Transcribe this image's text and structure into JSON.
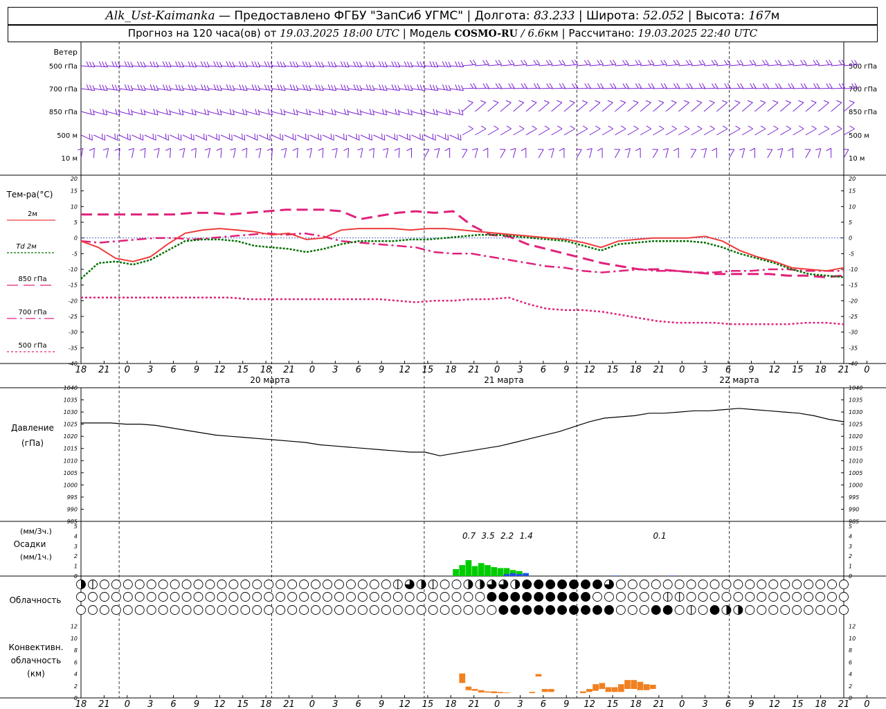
{
  "header": {
    "station": "Alk_Ust-Kaimanka",
    "provider": "— Предоставлено ФГБУ \"ЗапСиб УГМС\" | Долгота:",
    "lon": "83.233",
    "lat_label": "| Широта:",
    "lat": "52.052",
    "alt_label": "| Высота:",
    "alt": "167",
    "alt_unit": "м",
    "forecast_label": "Прогноз на 120 часа(ов) от",
    "forecast_from": "19.03.2025 18:00 UTC",
    "model_label": "| Модель",
    "model": "COSMO-RU",
    "resolution": "/ 6.6",
    "resolution_unit": "км",
    "calc_label": "| Рассчитано:",
    "calc_time": "19.03.2025 22:40 UTC"
  },
  "labels": {
    "wind_title": "Ветер",
    "wind_levels": [
      "500 гПа",
      "700 гПа",
      "850 гПа",
      "500 м",
      "10 м"
    ],
    "temp_title": "Тем-ра(°С)",
    "legend": [
      "2м",
      "Td 2м",
      "850 гПа",
      "700 гПа",
      "500 гПа"
    ],
    "pressure_title": "Давление",
    "pressure_unit": "(гПа)",
    "precip_unit_3h": "(мм/3ч.)",
    "precip_title": "Осадки",
    "precip_unit_1h": "(мм/1ч.)",
    "cloud_title": "Облачность",
    "conv_title_1": "Конвективн.",
    "conv_title_2": "облачность",
    "conv_unit": "(км)"
  },
  "colors": {
    "wind": "#7a1fd2",
    "t2m": "#ee3b3b",
    "td2m": "#007000",
    "t850": "#e0207a",
    "t700": "#e0207a",
    "t500": "#e0207a",
    "precip_rain": "#00cc00",
    "precip_snow": "#2050e0",
    "conv": "#f08020"
  },
  "chart_data": {
    "type": "meteogram",
    "x_hours": [
      0,
      3,
      6,
      9,
      12,
      15,
      18,
      21,
      24,
      27,
      30,
      33,
      36,
      39,
      42,
      45,
      48,
      51,
      54,
      57,
      60,
      63,
      66,
      69,
      72,
      75,
      78,
      81,
      84,
      87,
      90,
      93,
      96,
      99,
      102,
      105,
      108,
      111,
      114,
      117,
      120
    ],
    "x_tick_labels": [
      "18",
      "21",
      "0",
      "3",
      "6",
      "9",
      "12",
      "15",
      "18",
      "21",
      "0",
      "3",
      "6",
      "9",
      "12",
      "15",
      "18",
      "21",
      "0",
      "3",
      "6",
      "9",
      "12",
      "15",
      "18",
      "21",
      "0",
      "3",
      "6",
      "9",
      "12",
      "15",
      "18",
      "21",
      "0"
    ],
    "date_labels": [
      "20 марта",
      "21 марта",
      "22 марта"
    ],
    "temperature": {
      "ylim": [
        -40,
        20
      ],
      "yticks": [
        20,
        15,
        10,
        5,
        0,
        -5,
        -10,
        -15,
        -20,
        -25,
        -30,
        -35,
        -40
      ],
      "t2m": [
        -1,
        -3,
        -6.5,
        -7.5,
        -6,
        -2,
        1.5,
        2.5,
        3,
        2.5,
        2,
        1,
        1.5,
        -0.5,
        0,
        2.5,
        3,
        3,
        3,
        2.5,
        3,
        3,
        2.5,
        2,
        1.5,
        1,
        0.5,
        0,
        -0.5,
        -1.5,
        -3,
        -1,
        -0.5,
        0,
        0,
        0,
        0.5,
        -1,
        -4,
        -6,
        -7.5,
        -9.5,
        -10,
        -10.5,
        -9.5
      ],
      "td2m": [
        -13,
        -8,
        -7.5,
        -8.5,
        -7,
        -4,
        -1,
        -0.5,
        -0.5,
        -1,
        -2.5,
        -3,
        -3.5,
        -4.5,
        -3.5,
        -2,
        -1,
        -1,
        -1,
        -0.5,
        -0.5,
        0,
        0.5,
        1,
        1,
        0.5,
        0,
        -0.5,
        -1,
        -2.5,
        -4,
        -2,
        -1.5,
        -1,
        -1,
        -1,
        -1.5,
        -3,
        -5,
        -6.5,
        -8,
        -10,
        -11.5,
        -12,
        -12.5
      ],
      "t850": [
        7.5,
        7.5,
        7.5,
        7.5,
        7.5,
        7.5,
        8,
        8,
        7.5,
        8,
        8.5,
        9,
        9,
        9,
        8.5,
        6,
        7,
        8,
        8.5,
        8,
        8.5,
        4,
        1,
        0.5,
        -2,
        -3.5,
        -5,
        -6.5,
        -8,
        -9,
        -10,
        -10,
        -10.5,
        -11,
        -11.5,
        -11.5,
        -11.5,
        -11.5,
        -12,
        -12,
        -12.5,
        -12
      ],
      "t700": [
        -1,
        -1.5,
        -1,
        -0.5,
        0,
        0,
        -0.5,
        0,
        0.5,
        1,
        1.5,
        1,
        1.5,
        0.5,
        -1,
        -1.5,
        -2,
        -2.5,
        -3,
        -4.5,
        -5,
        -5,
        -6,
        -7,
        -8,
        -9,
        -9.5,
        -10.5,
        -11,
        -10.5,
        -10,
        -10.5,
        -10.5,
        -11,
        -11,
        -10.5,
        -10.5,
        -10,
        -10,
        -10.5,
        -10.5,
        -10.5
      ],
      "t500": [
        -19,
        -19,
        -19,
        -19,
        -19,
        -19,
        -19,
        -19,
        -19,
        -19.5,
        -19.5,
        -19.5,
        -19.5,
        -19.5,
        -19.5,
        -19.5,
        -19.5,
        -20,
        -20.5,
        -20,
        -20,
        -19.5,
        -19.5,
        -19,
        -21,
        -22.5,
        -23,
        -23,
        -23.5,
        -24.5,
        -25.5,
        -26.5,
        -27,
        -27,
        -27,
        -27.5,
        -27.5,
        -27.5,
        -27.5,
        -27,
        -27,
        -27.5
      ]
    },
    "pressure": {
      "ylim": [
        985,
        1040
      ],
      "yticks": [
        1040,
        1035,
        1030,
        1025,
        1020,
        1015,
        1010,
        1005,
        1000,
        995,
        990,
        985
      ],
      "values": [
        1025.5,
        1025.5,
        1025.5,
        1025,
        1025,
        1024.5,
        1023.5,
        1022.5,
        1021.5,
        1020.5,
        1020,
        1019.5,
        1019,
        1018.5,
        1018,
        1017.5,
        1016.5,
        1016,
        1015.5,
        1015,
        1014.5,
        1014,
        1013.5,
        1013.5,
        1012,
        1013,
        1014,
        1015,
        1016,
        1017.5,
        1019,
        1020.5,
        1022,
        1024,
        1026,
        1027.5,
        1028,
        1028.5,
        1029.5,
        1029.5,
        1030,
        1030.5,
        1030.5,
        1031,
        1031.5,
        1031,
        1030.5,
        1030,
        1029.5,
        1028.5,
        1027,
        1026
      ]
    },
    "precip_totals_3h": [
      {
        "hour": 63,
        "label": "0.7"
      },
      {
        "hour": 66,
        "label": "3.5"
      },
      {
        "hour": 69,
        "label": "2.2"
      },
      {
        "hour": 72,
        "label": "1.4"
      },
      {
        "hour": 93,
        "label": "0.1"
      }
    ],
    "precip_hourly": {
      "ylim": [
        0,
        5
      ],
      "rain": [
        [
          59,
          0.7
        ],
        [
          60,
          1.1
        ],
        [
          61,
          1.6
        ],
        [
          62,
          1.0
        ],
        [
          63,
          1.3
        ],
        [
          64,
          1.1
        ],
        [
          65,
          0.9
        ],
        [
          66,
          0.8
        ],
        [
          67,
          0.8
        ],
        [
          68,
          0.6
        ],
        [
          69,
          0.5
        ]
      ],
      "snow": [
        [
          67,
          0.2
        ],
        [
          68,
          0.3
        ],
        [
          69,
          0.2
        ],
        [
          70,
          0.3
        ],
        [
          84,
          0.05
        ],
        [
          93,
          0.05
        ]
      ]
    },
    "convective_cloud": {
      "ylim": [
        0,
        13
      ],
      "yticks": [
        12,
        10,
        8,
        6,
        4,
        2,
        0
      ],
      "bars": [
        [
          60,
          2.5,
          4.1
        ],
        [
          61,
          1.3,
          1.9
        ],
        [
          62,
          1.2,
          1.5
        ],
        [
          63,
          0.9,
          1.3
        ],
        [
          64,
          0.9,
          1.1
        ],
        [
          65,
          0.8,
          1.1
        ],
        [
          66,
          0.8,
          1.0
        ],
        [
          67,
          0.8,
          0.9
        ],
        [
          71,
          0.8,
          1.0
        ],
        [
          72,
          3.6,
          4.0
        ],
        [
          73,
          1.0,
          1.5
        ],
        [
          74,
          1.0,
          1.5
        ],
        [
          79,
          0.8,
          1.1
        ],
        [
          80,
          1.0,
          1.5
        ],
        [
          81,
          1.2,
          2.3
        ],
        [
          82,
          1.5,
          2.5
        ],
        [
          83,
          1.0,
          1.8
        ],
        [
          84,
          1.0,
          1.8
        ],
        [
          85,
          1.0,
          2.3
        ],
        [
          86,
          1.5,
          3.0
        ],
        [
          87,
          1.5,
          3.0
        ],
        [
          88,
          1.3,
          2.7
        ],
        [
          89,
          1.3,
          2.3
        ],
        [
          90,
          1.5,
          2.2
        ]
      ]
    },
    "cloud_cover": {
      "rows": [
        "upper",
        "middle",
        "lower"
      ],
      "upper": [
        2,
        2,
        1,
        1,
        0,
        0,
        0,
        0,
        0,
        0,
        0,
        0,
        0,
        0,
        0,
        0,
        0,
        0,
        0,
        0,
        0,
        0,
        0,
        0,
        0,
        0,
        0,
        0,
        0,
        0,
        0,
        0,
        0,
        0,
        0,
        0,
        0,
        0,
        0,
        0,
        0,
        0,
        0,
        0,
        0,
        0,
        0,
        0,
        0,
        0,
        1,
        1,
        3,
        3,
        2,
        1,
        1,
        0,
        0,
        0,
        2,
        2,
        2,
        2,
        2,
        3,
        3,
        4,
        2,
        4,
        4,
        3,
        4,
        4,
        4,
        4,
        4,
        4,
        4,
        4,
        4,
        4,
        3,
        3,
        3,
        0,
        0,
        0,
        0,
        0,
        0,
        0,
        0,
        0,
        0,
        0,
        0,
        0,
        0,
        0,
        0,
        0,
        0,
        0,
        0,
        0,
        0,
        0,
        0,
        0,
        0,
        0,
        0,
        0,
        0,
        0,
        0,
        0,
        0,
        0,
        0
      ],
      "middle": [
        0,
        0,
        0,
        0,
        0,
        0,
        0,
        0,
        0,
        0,
        0,
        0,
        0,
        0,
        0,
        0,
        0,
        0,
        0,
        0,
        0,
        0,
        0,
        0,
        0,
        0,
        0,
        0,
        0,
        0,
        0,
        0,
        0,
        0,
        0,
        0,
        0,
        0,
        0,
        0,
        0,
        0,
        0,
        0,
        0,
        0,
        0,
        0,
        0,
        0,
        0,
        0,
        0,
        0,
        0,
        0,
        0,
        0,
        0,
        0,
        0,
        0,
        0,
        0,
        3,
        4,
        4,
        4,
        4,
        4,
        4,
        4,
        4,
        4,
        4,
        4,
        4,
        4,
        4,
        4,
        4,
        0,
        0,
        0,
        0,
        0,
        0,
        0,
        0,
        0,
        0,
        0,
        1,
        1,
        1,
        1,
        0,
        0,
        0,
        0,
        0,
        0,
        0,
        0,
        0,
        0,
        0,
        0,
        0,
        0,
        0,
        0,
        0,
        0,
        0,
        0,
        0,
        0,
        0,
        0,
        0
      ],
      "lower": [
        0,
        0,
        0,
        0,
        0,
        0,
        0,
        0,
        0,
        0,
        0,
        0,
        0,
        0,
        0,
        0,
        0,
        0,
        0,
        0,
        0,
        0,
        0,
        0,
        0,
        0,
        0,
        0,
        0,
        0,
        0,
        0,
        0,
        0,
        0,
        0,
        0,
        0,
        0,
        0,
        0,
        0,
        0,
        0,
        0,
        0,
        0,
        0,
        0,
        0,
        0,
        0,
        0,
        0,
        0,
        0,
        0,
        0,
        0,
        0,
        0,
        0,
        0,
        0,
        0,
        0,
        4,
        4,
        4,
        4,
        4,
        4,
        4,
        4,
        4,
        4,
        4,
        4,
        4,
        4,
        4,
        4,
        4,
        4,
        4,
        0,
        0,
        0,
        0,
        0,
        4,
        4,
        4,
        0,
        0,
        2,
        1,
        0,
        0,
        1,
        4,
        1,
        2,
        2,
        3,
        0,
        0,
        0,
        0,
        0,
        0,
        0,
        0,
        0,
        0,
        0,
        0,
        0,
        0,
        0,
        0
      ]
    }
  }
}
